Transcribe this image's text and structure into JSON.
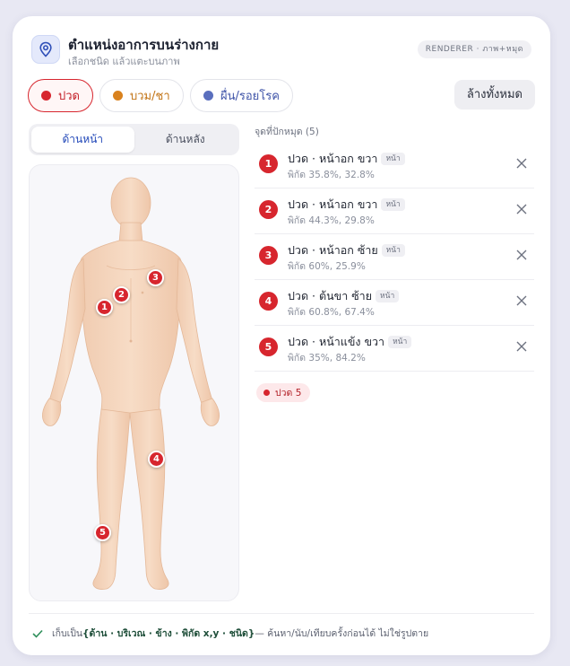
{
  "header": {
    "title": "ตำแหน่งอาการบนร่างกาย",
    "subtitle": "เลือกชนิด แล้วแตะบนภาพ",
    "badge": "RENDERER · ภาพ+หมุด"
  },
  "symptoms": [
    {
      "label": "ปวด",
      "color": "#d7262e",
      "active": true
    },
    {
      "label": "บวม/ชา",
      "color": "#d9821e",
      "active": false
    },
    {
      "label": "ผื่น/รอยโรค",
      "color": "#5a6fbe",
      "active": false
    }
  ],
  "clear_label": "ล้างทั้งหมด",
  "views": [
    {
      "label": "ด้านหน้า",
      "active": true
    },
    {
      "label": "ด้านหลัง",
      "active": false
    }
  ],
  "list_title": "จุดที่ปักหมุด (5)",
  "pins": [
    {
      "num": "1",
      "label": "ปวด · หน้าอก ขวา",
      "tag": "หน้า",
      "coord": "พิกัด 35.8%, 32.8%"
    },
    {
      "num": "2",
      "label": "ปวด · หน้าอก ขวา",
      "tag": "หน้า",
      "coord": "พิกัด 44.3%, 29.8%"
    },
    {
      "num": "3",
      "label": "ปวด · หน้าอก ซ้าย",
      "tag": "หน้า",
      "coord": "พิกัด 60%, 25.9%"
    },
    {
      "num": "4",
      "label": "ปวด · ต้นขา ซ้าย",
      "tag": "หน้า",
      "coord": "พิกัด 60.8%, 67.4%"
    },
    {
      "num": "5",
      "label": "ปวด · หน้าแข้ง ขวา",
      "tag": "หน้า",
      "coord": "พิกัด 35%, 84.2%"
    }
  ],
  "summary_badge": "ปวด 5",
  "footer": {
    "prefix": "เก็บเป็น ",
    "emphasis": "{ด้าน · บริเวณ · ข้าง · พิกัด x,y · ชนิด}",
    "suffix": " — ค้นหา/นับ/เทียบครั้งก่อนได้ ไม่ใช่รูปตาย"
  }
}
